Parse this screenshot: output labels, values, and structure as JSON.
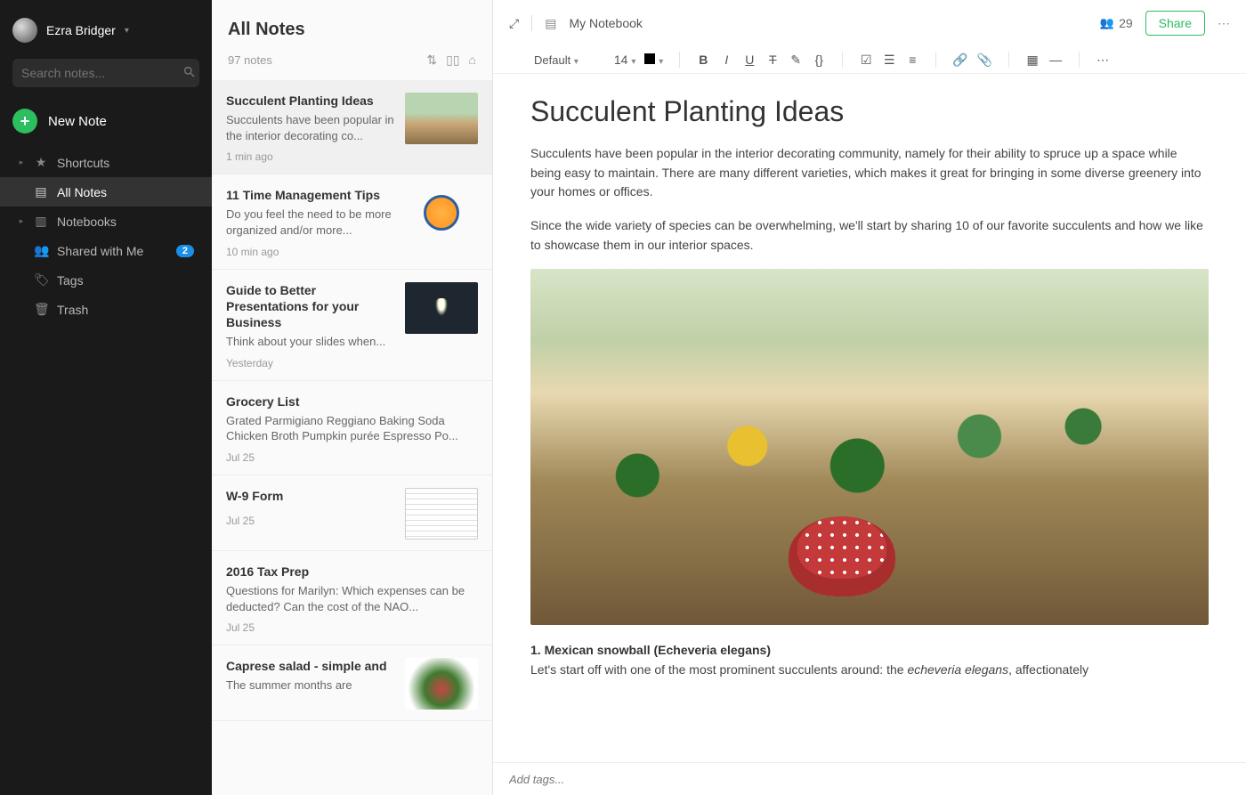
{
  "user": {
    "name": "Ezra Bridger"
  },
  "search": {
    "placeholder": "Search notes..."
  },
  "newNote": {
    "label": "New Note"
  },
  "sidebar": {
    "items": [
      {
        "label": "Shortcuts"
      },
      {
        "label": "All Notes"
      },
      {
        "label": "Notebooks"
      },
      {
        "label": "Shared with Me",
        "badge": "2"
      },
      {
        "label": "Tags"
      },
      {
        "label": "Trash"
      }
    ]
  },
  "notelist": {
    "title": "All Notes",
    "count": "97 notes",
    "items": [
      {
        "title": "Succulent Planting Ideas",
        "snippet": "Succulents have been popular in the interior decorating co...",
        "time": "1 min ago"
      },
      {
        "title": "11 Time Management Tips",
        "snippet": "Do you feel the need to be more organized and/or more...",
        "time": "10 min ago"
      },
      {
        "title": "Guide to Better Presentations for your Business",
        "snippet": "Think about your slides when...",
        "time": "Yesterday"
      },
      {
        "title": "Grocery List",
        "snippet": "Grated Parmigiano Reggiano Baking Soda Chicken Broth Pumpkin purée Espresso Po...",
        "time": "Jul 25"
      },
      {
        "title": "W-9 Form",
        "snippet": "",
        "time": "Jul 25"
      },
      {
        "title": "2016 Tax Prep",
        "snippet": "Questions for Marilyn: Which expenses can be deducted? Can the cost of the NAO...",
        "time": "Jul 25"
      },
      {
        "title": "Caprese salad - simple and",
        "snippet": "The summer months are",
        "time": ""
      }
    ]
  },
  "editor": {
    "notebook": "My Notebook",
    "shareCount": "29",
    "shareLabel": "Share",
    "font": "Default",
    "fontSize": "14",
    "title": "Succulent Planting Ideas",
    "para1": "Succulents have been popular in the interior decorating community, namely for their ability to spruce up a space while being easy to maintain. There are many different varieties, which makes it great for bringing in some diverse greenery into your homes or offices.",
    "para2": "Since the wide variety of species can be overwhelming, we'll start by sharing 10 of our favorite succulents and how we like to showcase them in our interior spaces.",
    "heading1": "1. Mexican snowball (Echeveria elegans)",
    "para3_a": "Let's start off with one of the most prominent succulents around: the ",
    "para3_em": "echeveria elegans",
    "para3_b": ", affectionately",
    "tagPlaceholder": "Add tags..."
  }
}
